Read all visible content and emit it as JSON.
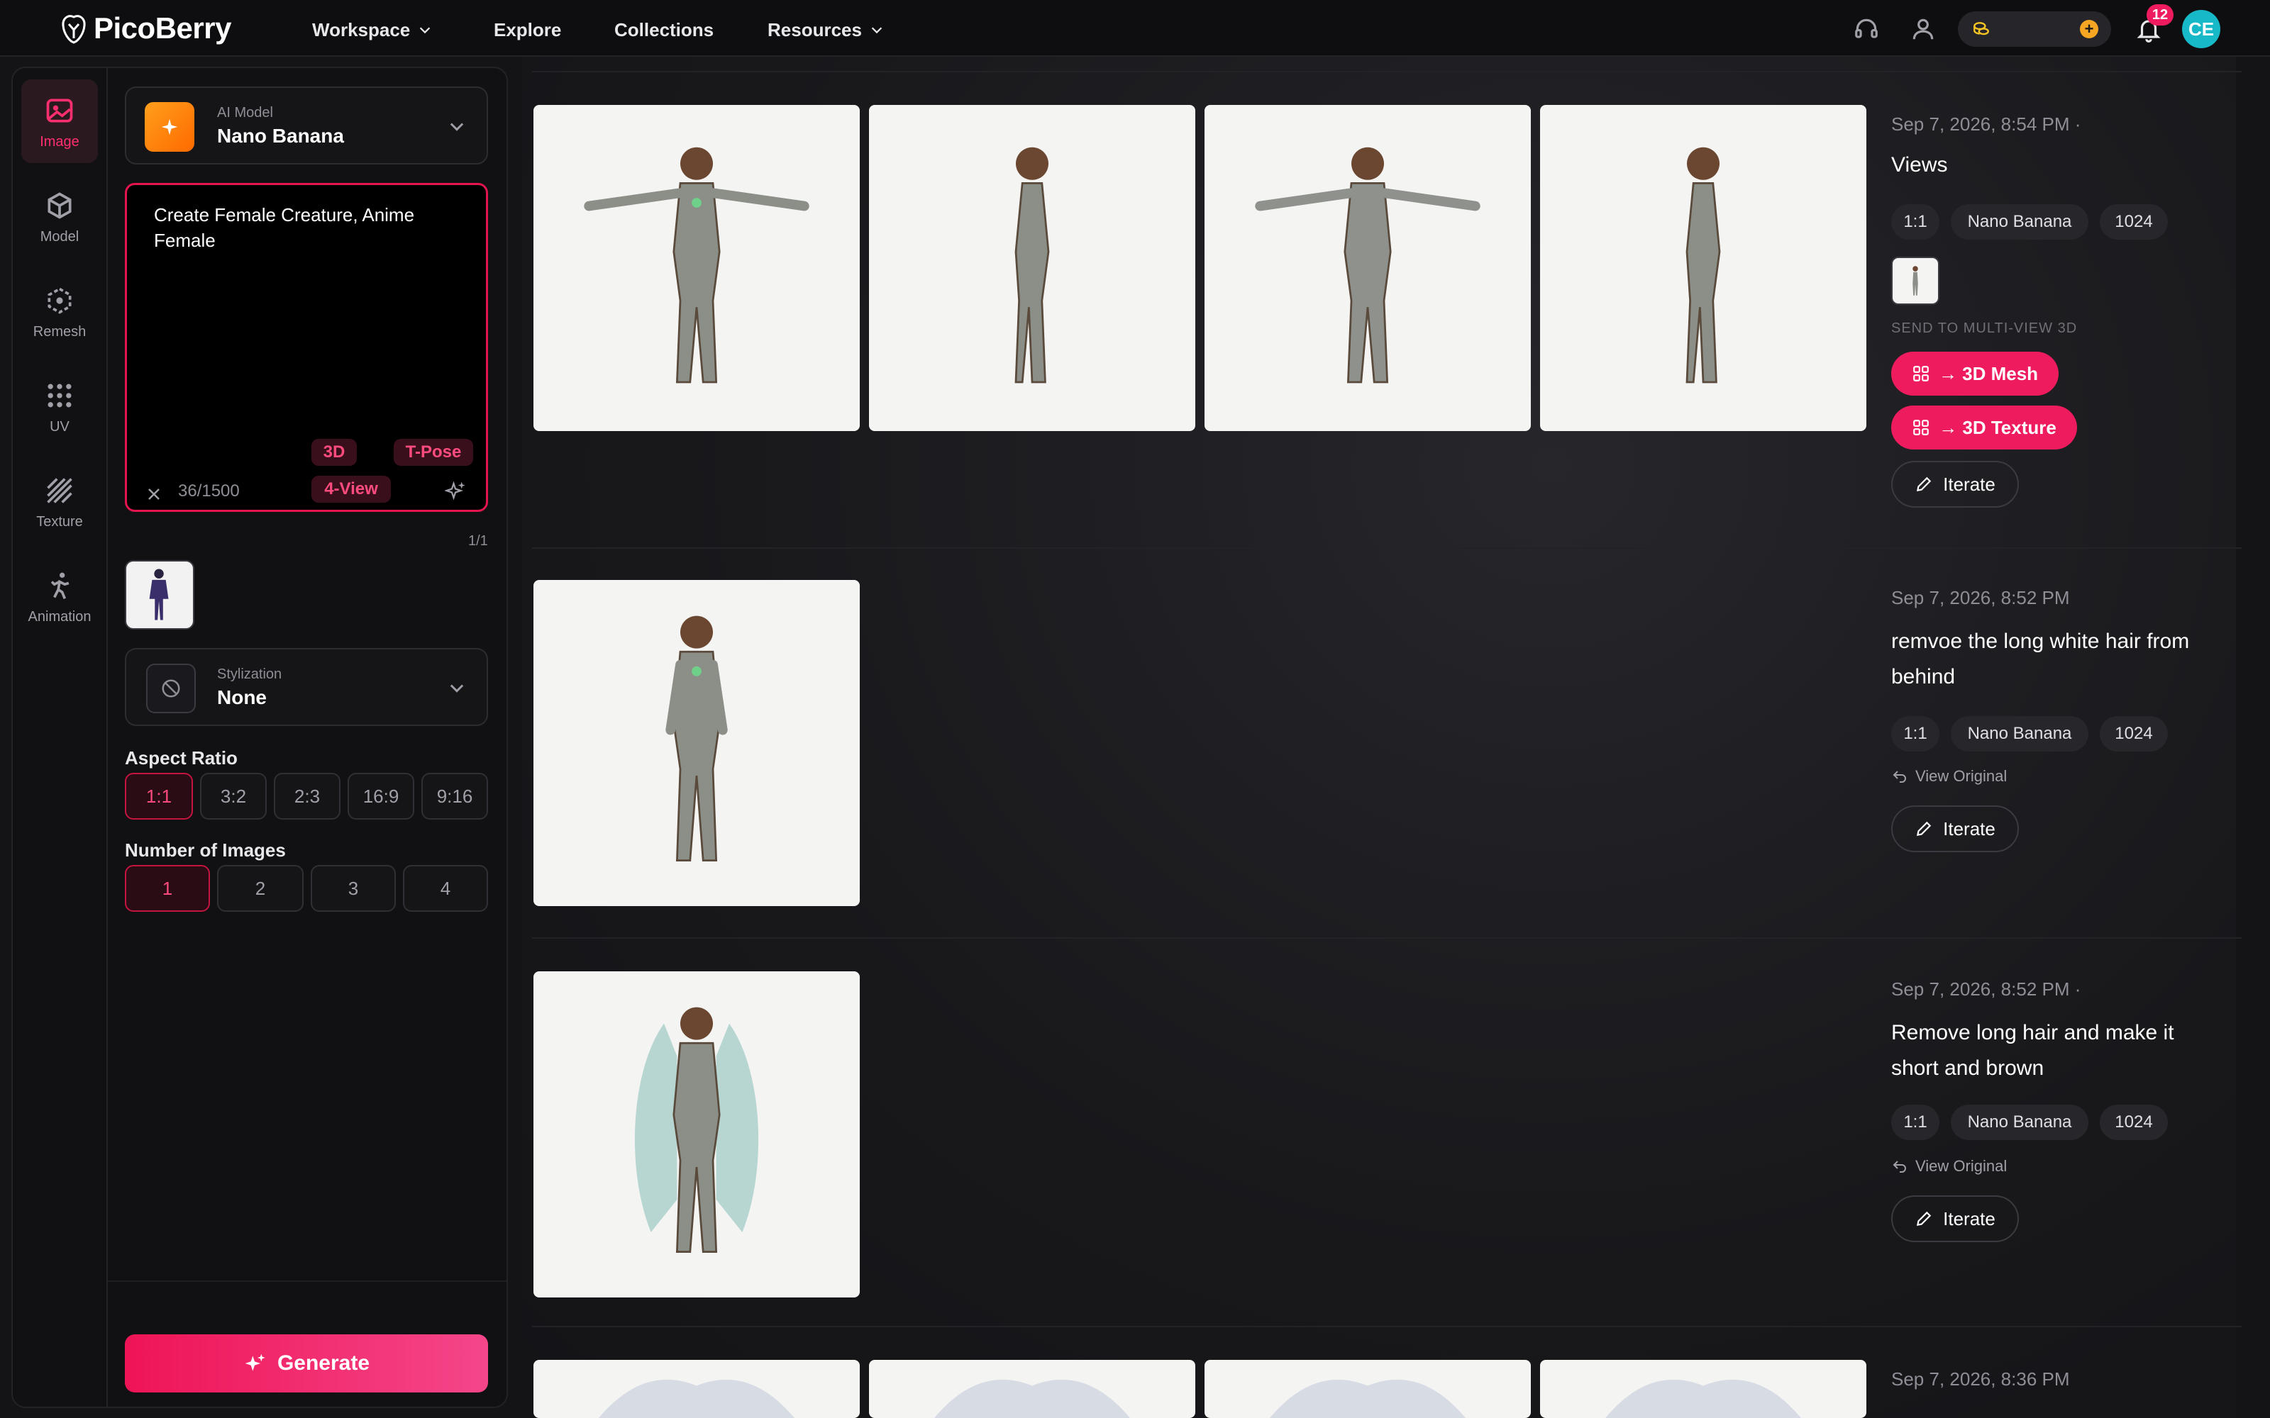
{
  "brand": {
    "name": "PicoBerry"
  },
  "nav": {
    "workspace": "Workspace",
    "explore": "Explore",
    "collections": "Collections",
    "resources": "Resources"
  },
  "topbar": {
    "notifications_count": "12",
    "avatar_initials": "CE",
    "credits_plus": "+"
  },
  "rail": {
    "image": "Image",
    "model": "Model",
    "remesh": "Remesh",
    "uv": "UV",
    "texture": "Texture",
    "animation": "Animation"
  },
  "ai_model": {
    "caption": "AI Model",
    "value": "Nano Banana"
  },
  "prompt": {
    "text": "Create Female Creature, Anime Female",
    "char_count": "36/1500",
    "tags": {
      "t3d": "3D",
      "tpose": "T-Pose",
      "fourview": "4-View"
    }
  },
  "reference": {
    "page": "1/1"
  },
  "stylization": {
    "caption": "Stylization",
    "value": "None"
  },
  "aspect_ratio": {
    "label": "Aspect Ratio",
    "options": [
      "1:1",
      "3:2",
      "2:3",
      "16:9",
      "9:16"
    ],
    "selected": "1:1"
  },
  "num_images": {
    "label": "Number of Images",
    "options": [
      "1",
      "2",
      "3",
      "4"
    ],
    "selected": "1"
  },
  "generate_label": "Generate",
  "feed": [
    {
      "time": "Sep 7, 2026, 8:54 PM ·",
      "title": "Views",
      "chips": [
        "1:1",
        "Nano Banana",
        "1024"
      ],
      "send_label": "SEND TO MULTI-VIEW 3D",
      "mesh_btn": "→ 3D Mesh",
      "texture_btn": "→ 3D Texture",
      "iterate": "Iterate"
    },
    {
      "time": "Sep 7, 2026, 8:52 PM",
      "title": "remvoe the long white hair from behind",
      "chips": [
        "1:1",
        "Nano Banana",
        "1024"
      ],
      "view_original": "View Original",
      "iterate": "Iterate"
    },
    {
      "time": "Sep 7, 2026, 8:52 PM ·",
      "title": "Remove long hair and make it short and brown",
      "chips": [
        "1:1",
        "Nano Banana",
        "1024"
      ],
      "view_original": "View Original",
      "iterate": "Iterate"
    },
    {
      "time": "Sep 7, 2026, 8:36 PM"
    }
  ],
  "colors": {
    "accent": "#ee1c5e",
    "background": "#141417",
    "panel": "#111113",
    "avatar": "#17b8c7",
    "model_icon": "#ff8a00"
  },
  "icons": [
    "image-icon",
    "cube-icon",
    "remesh-icon",
    "grid-icon",
    "texture-icon",
    "running-person-icon",
    "headset-icon",
    "user-icon",
    "coins-icon",
    "bell-icon",
    "chevron-down-icon",
    "close-icon",
    "sparkle-icon",
    "ban-icon",
    "undo-arrow-icon",
    "pencil-icon",
    "grid-four-icon"
  ]
}
